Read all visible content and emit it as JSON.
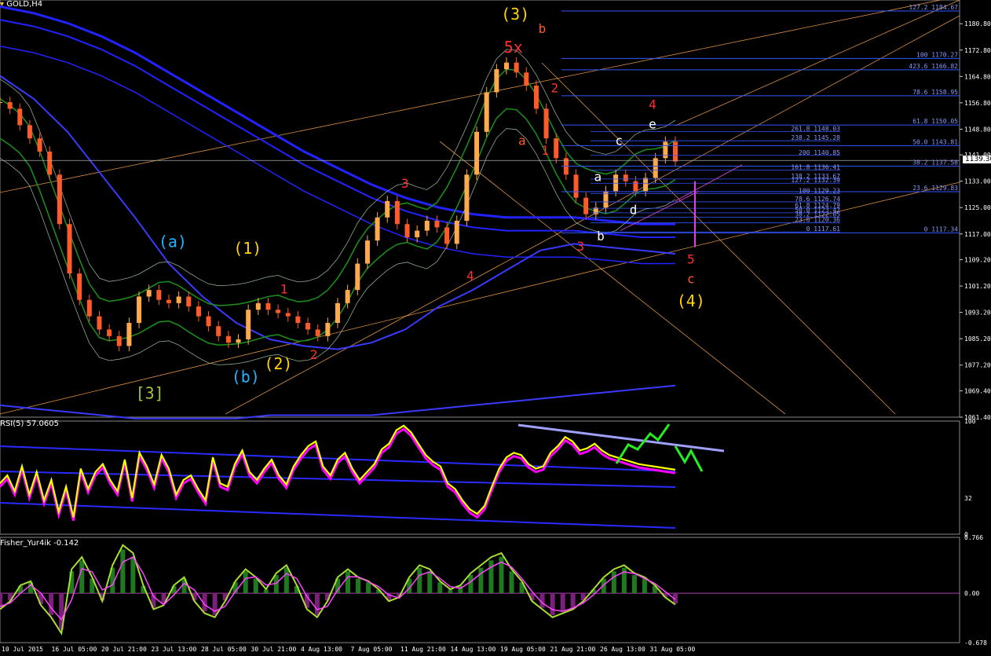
{
  "window": {
    "title": "GOLD,H4"
  },
  "colors": {
    "background": "#000000",
    "axis": "#ffffff",
    "fib": "#3355ff",
    "trend": "#ffa94d",
    "ema": "#2222ff",
    "band": "#1a8a1a",
    "rsi": "#ffff00",
    "rsi_ma": "#ff00ff",
    "fisher_line": "#aadd33",
    "fisher_signal": "#ff44ff",
    "hist_pos": "#1f7a1f",
    "hist_neg": "#7a1f7a",
    "bull": "#ffa94d",
    "bear": "#ff5a2a"
  },
  "chart_data": [
    {
      "type": "line",
      "name": "price",
      "title": "GOLD,H4",
      "ylim": [
        1061.4,
        1188
      ],
      "y_ticks": [
        "1180.80",
        "1172.80",
        "1164.80",
        "1156.80",
        "1148.80",
        "1141.00",
        "1133.00",
        "1125.00",
        "1117.00",
        "1109.20",
        "1101.20",
        "1093.20",
        "1085.20",
        "1077.20",
        "1069.40",
        "1061.40"
      ],
      "y_tick_values": [
        1180.8,
        1172.8,
        1164.8,
        1156.8,
        1148.8,
        1141,
        1133,
        1125,
        1117,
        1109.2,
        1101.2,
        1093.2,
        1085.2,
        1077.2,
        1069.4,
        1061.4
      ],
      "current_price": "1139.30",
      "current_price_value": 1139.3,
      "x_labels": [
        "10 Jul 2015",
        "16 Jul 05:00",
        "20 Jul 21:00",
        "23 Jul 13:00",
        "28 Jul 05:00",
        "30 Jul 21:00",
        "4 Aug 13:00",
        "7 Aug 05:00",
        "11 Aug 21:00",
        "14 Aug 13:00",
        "19 Aug 05:00",
        "21 Aug 21:00",
        "26 Aug 13:00",
        "31 Aug 05:00"
      ],
      "price_path": [
        1157,
        1155,
        1150,
        1146,
        1142,
        1135,
        1120,
        1105,
        1097,
        1092,
        1088,
        1086,
        1083,
        1090,
        1098,
        1100,
        1097,
        1096,
        1098,
        1095,
        1092,
        1089,
        1086,
        1084,
        1085,
        1094,
        1096,
        1094,
        1093,
        1092,
        1090,
        1088,
        1086,
        1090,
        1096,
        1100,
        1108,
        1115,
        1122,
        1127,
        1120,
        1116,
        1118,
        1121,
        1119,
        1114,
        1121,
        1135,
        1148,
        1160,
        1167,
        1169,
        1166,
        1162,
        1155,
        1146,
        1140,
        1135,
        1128,
        1123,
        1125,
        1130,
        1135,
        1133,
        1130,
        1134,
        1140,
        1145,
        1139
      ],
      "fib_right": [
        {
          "label": "127.2 1184.67",
          "value": 1184.67
        },
        {
          "label": "100 1170.27",
          "value": 1170.27
        },
        {
          "label": "423.6 1166.82",
          "value": 1166.82
        },
        {
          "label": "78.6 1158.95",
          "value": 1158.95
        },
        {
          "label": "61.8 1150.05",
          "value": 1150.05
        },
        {
          "label": "50.0 1143.81",
          "value": 1143.81
        },
        {
          "label": "38.2 1137.58",
          "value": 1137.58
        },
        {
          "label": "23.6 1129.83",
          "value": 1129.83
        },
        {
          "label": "0 1117.34",
          "value": 1117.34
        }
      ],
      "fib_mid": [
        {
          "label": "261.8 1148.03",
          "value": 1148.03
        },
        {
          "label": "238.2 1145.28",
          "value": 1145.28
        },
        {
          "label": "200 1140.85",
          "value": 1140.85
        },
        {
          "label": "161.8 1136.41",
          "value": 1136.41
        },
        {
          "label": "138.2 1133.67",
          "value": 1133.67
        },
        {
          "label": "127.2 1132.39",
          "value": 1132.39
        },
        {
          "label": "100 1129.23",
          "value": 1129.23
        },
        {
          "label": "78.6 1126.74",
          "value": 1126.74
        },
        {
          "label": "61.8 1124.79",
          "value": 1124.79
        },
        {
          "label": "50.0 1123.42",
          "value": 1123.42
        },
        {
          "label": "38.2 1122.05",
          "value": 1122.05
        },
        {
          "label": "23.6 1120.36",
          "value": 1120.36
        },
        {
          "label": "0 1117.61",
          "value": 1117.61
        }
      ],
      "annotations": [
        {
          "text": "(3)",
          "color": "#ffd400",
          "xi": 0.537,
          "y": 1182
        },
        {
          "text": "b",
          "color": "#ff5a2a",
          "xi": 0.565,
          "y": 1178
        },
        {
          "text": "5x",
          "color": "#ff3030",
          "xi": 0.535,
          "y": 1172
        },
        {
          "text": "2",
          "color": "#ff3030",
          "xi": 0.578,
          "y": 1160
        },
        {
          "text": "4",
          "color": "#ff3030",
          "xi": 0.68,
          "y": 1155
        },
        {
          "text": "e",
          "color": "#ffffff",
          "xi": 0.68,
          "y": 1149
        },
        {
          "text": "a",
          "color": "#ff5a2a",
          "xi": 0.544,
          "y": 1144
        },
        {
          "text": "c",
          "color": "#ffffff",
          "xi": 0.645,
          "y": 1144
        },
        {
          "text": "1",
          "color": "#ff3030",
          "xi": 0.568,
          "y": 1141
        },
        {
          "text": "a",
          "color": "#ffffff",
          "xi": 0.623,
          "y": 1133
        },
        {
          "text": "3",
          "color": "#ff3030",
          "xi": 0.422,
          "y": 1131
        },
        {
          "text": "d",
          "color": "#ffffff",
          "xi": 0.66,
          "y": 1123
        },
        {
          "text": "b",
          "color": "#ffffff",
          "xi": 0.626,
          "y": 1115
        },
        {
          "text": "(a)",
          "color": "#22b3ff",
          "xi": 0.18,
          "y": 1113
        },
        {
          "text": "(1)",
          "color": "#ffd400",
          "xi": 0.258,
          "y": 1111
        },
        {
          "text": "3",
          "color": "#ff3030",
          "xi": 0.605,
          "y": 1112
        },
        {
          "text": "5",
          "color": "#ff3030",
          "xi": 0.72,
          "y": 1108
        },
        {
          "text": "4",
          "color": "#ff3030",
          "xi": 0.49,
          "y": 1103
        },
        {
          "text": "c",
          "color": "#ff5a2a",
          "xi": 0.72,
          "y": 1102
        },
        {
          "text": "1",
          "color": "#ff3030",
          "xi": 0.296,
          "y": 1099
        },
        {
          "text": "(4)",
          "color": "#ffd400",
          "xi": 0.72,
          "y": 1095
        },
        {
          "text": "2",
          "color": "#ff3030",
          "xi": 0.327,
          "y": 1079
        },
        {
          "text": "(2)",
          "color": "#ffd400",
          "xi": 0.29,
          "y": 1076
        },
        {
          "text": "(b)",
          "color": "#22b3ff",
          "xi": 0.256,
          "y": 1072
        },
        {
          "text": "[3]",
          "color": "#a0c830",
          "xi": 0.156,
          "y": 1067
        }
      ]
    },
    {
      "type": "line",
      "name": "RSI(5)",
      "title": "RSI(5) 57.0605",
      "ylim": [
        0,
        100
      ],
      "y_ticks": [
        "100",
        "32",
        "0"
      ],
      "y_tick_values": [
        100,
        32,
        0
      ],
      "values": [
        45,
        52,
        38,
        60,
        35,
        55,
        30,
        48,
        20,
        42,
        15,
        58,
        40,
        55,
        62,
        48,
        38,
        66,
        32,
        72,
        60,
        44,
        70,
        58,
        35,
        48,
        52,
        40,
        30,
        68,
        45,
        42,
        62,
        74,
        55,
        48,
        58,
        66,
        52,
        44,
        60,
        70,
        78,
        82,
        60,
        52,
        66,
        72,
        58,
        48,
        55,
        62,
        75,
        80,
        92,
        96,
        90,
        80,
        70,
        64,
        60,
        45,
        40,
        30,
        22,
        18,
        25,
        42,
        58,
        68,
        72,
        70,
        62,
        58,
        60,
        72,
        78,
        86,
        82,
        74,
        76,
        80,
        74,
        70,
        68,
        66,
        64,
        62,
        61,
        60,
        59,
        58,
        57.0605
      ]
    },
    {
      "type": "bar",
      "name": "Fisher_Yur4ik",
      "title": "Fisher_Yur4ik -0.142",
      "ylim": [
        -0.678,
        0.766
      ],
      "y_ticks": [
        "0.766",
        "0.00",
        "-0.678"
      ],
      "y_tick_values": [
        0.766,
        0,
        -0.678
      ],
      "values": [
        -0.2,
        -0.1,
        0.1,
        0.15,
        -0.15,
        -0.3,
        -0.5,
        0.3,
        0.45,
        0.2,
        -0.1,
        0.35,
        0.6,
        0.5,
        0.1,
        -0.2,
        -0.15,
        0.1,
        0.2,
        -0.1,
        -0.25,
        -0.3,
        -0.1,
        0.15,
        0.3,
        0.2,
        0.05,
        0.25,
        0.35,
        0.1,
        -0.2,
        -0.3,
        -0.1,
        0.2,
        0.3,
        0.2,
        0.15,
        0.05,
        -0.1,
        -0.05,
        0.2,
        0.35,
        0.3,
        0.15,
        0.05,
        0.1,
        0.25,
        0.35,
        0.45,
        0.5,
        0.3,
        0.15,
        -0.1,
        -0.2,
        -0.3,
        -0.25,
        -0.2,
        -0.1,
        0.05,
        0.2,
        0.3,
        0.35,
        0.25,
        0.2,
        0.1,
        -0.05,
        -0.142
      ]
    }
  ]
}
